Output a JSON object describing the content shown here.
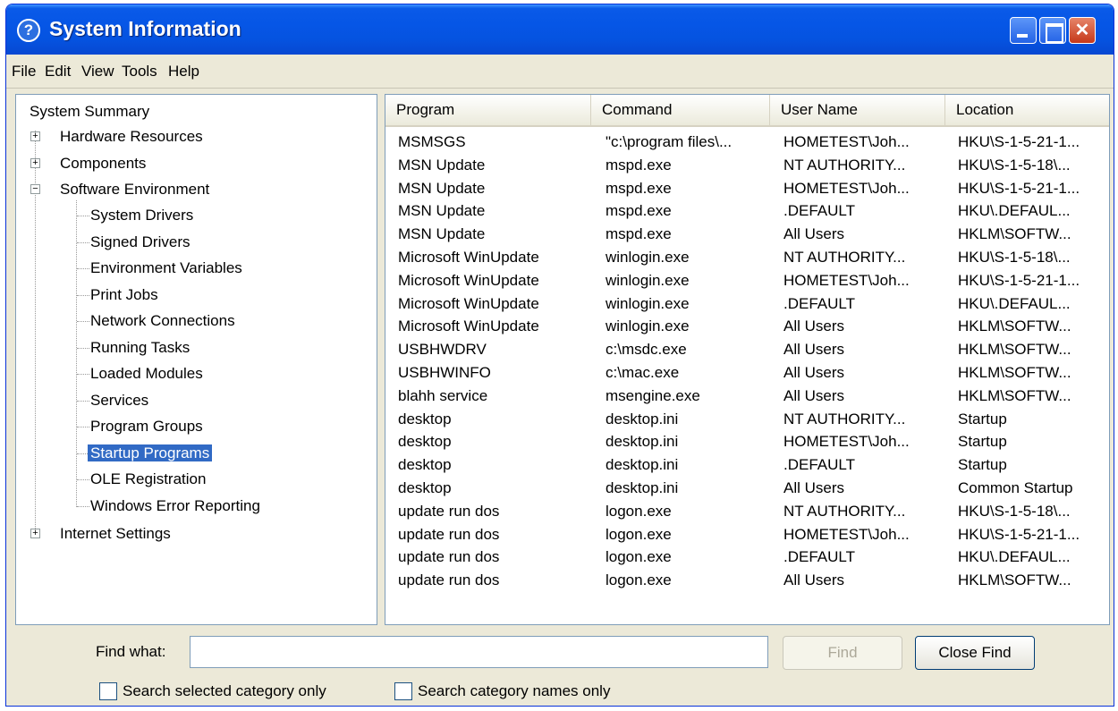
{
  "window": {
    "title": "System Information",
    "help_glyph": "?"
  },
  "menu": [
    "File",
    "Edit",
    "View",
    "Tools",
    "Help"
  ],
  "tree": {
    "root": "System Summary",
    "top_items": [
      {
        "label": "Hardware Resources",
        "state": "+"
      },
      {
        "label": "Components",
        "state": "+"
      },
      {
        "label": "Software Environment",
        "state": "−"
      }
    ],
    "children": [
      "System Drivers",
      "Signed Drivers",
      "Environment Variables",
      "Print Jobs",
      "Network Connections",
      "Running Tasks",
      "Loaded Modules",
      "Services",
      "Program Groups",
      "Startup Programs",
      "OLE Registration",
      "Windows Error Reporting"
    ],
    "selected": "Startup Programs",
    "last_item": {
      "label": "Internet Settings",
      "state": "+"
    }
  },
  "table": {
    "columns": [
      "Program",
      "Command",
      "User Name",
      "Location"
    ],
    "rows": [
      [
        "MSMSGS",
        "\"c:\\program files\\...",
        "HOMETEST\\Joh...",
        "HKU\\S-1-5-21-1..."
      ],
      [
        "MSN Update",
        "mspd.exe",
        "NT AUTHORITY...",
        "HKU\\S-1-5-18\\..."
      ],
      [
        "MSN Update",
        "mspd.exe",
        "HOMETEST\\Joh...",
        "HKU\\S-1-5-21-1..."
      ],
      [
        "MSN Update",
        "mspd.exe",
        ".DEFAULT",
        "HKU\\.DEFAUL..."
      ],
      [
        "MSN Update",
        "mspd.exe",
        "All Users",
        "HKLM\\SOFTW..."
      ],
      [
        "Microsoft WinUpdate",
        "winlogin.exe",
        "NT AUTHORITY...",
        "HKU\\S-1-5-18\\..."
      ],
      [
        "Microsoft WinUpdate",
        "winlogin.exe",
        "HOMETEST\\Joh...",
        "HKU\\S-1-5-21-1..."
      ],
      [
        "Microsoft WinUpdate",
        "winlogin.exe",
        ".DEFAULT",
        "HKU\\.DEFAUL..."
      ],
      [
        "Microsoft WinUpdate",
        "winlogin.exe",
        "All Users",
        "HKLM\\SOFTW..."
      ],
      [
        "USBHWDRV",
        "c:\\msdc.exe",
        "All Users",
        "HKLM\\SOFTW..."
      ],
      [
        "USBHWINFO",
        "c:\\mac.exe",
        "All Users",
        "HKLM\\SOFTW..."
      ],
      [
        "blahh service",
        "msengine.exe",
        "All Users",
        "HKLM\\SOFTW..."
      ],
      [
        "desktop",
        "desktop.ini",
        "NT AUTHORITY...",
        "Startup"
      ],
      [
        "desktop",
        "desktop.ini",
        "HOMETEST\\Joh...",
        "Startup"
      ],
      [
        "desktop",
        "desktop.ini",
        ".DEFAULT",
        "Startup"
      ],
      [
        "desktop",
        "desktop.ini",
        "All Users",
        "Common Startup"
      ],
      [
        "update run dos",
        "logon.exe",
        "NT AUTHORITY...",
        "HKU\\S-1-5-18\\..."
      ],
      [
        "update run dos",
        "logon.exe",
        "HOMETEST\\Joh...",
        "HKU\\S-1-5-21-1..."
      ],
      [
        "update run dos",
        "logon.exe",
        ".DEFAULT",
        "HKU\\.DEFAUL..."
      ],
      [
        "update run dos",
        "logon.exe",
        "All Users",
        "HKLM\\SOFTW..."
      ]
    ]
  },
  "find": {
    "label": "Find what:",
    "value": "",
    "find_button": "Find",
    "close_button": "Close Find",
    "check_selected": "Search selected category only",
    "check_names": "Search category names only"
  },
  "colors": {
    "titlebar": "#0656e6",
    "selection": "#316ac5",
    "window_bg": "#ece9d8"
  }
}
